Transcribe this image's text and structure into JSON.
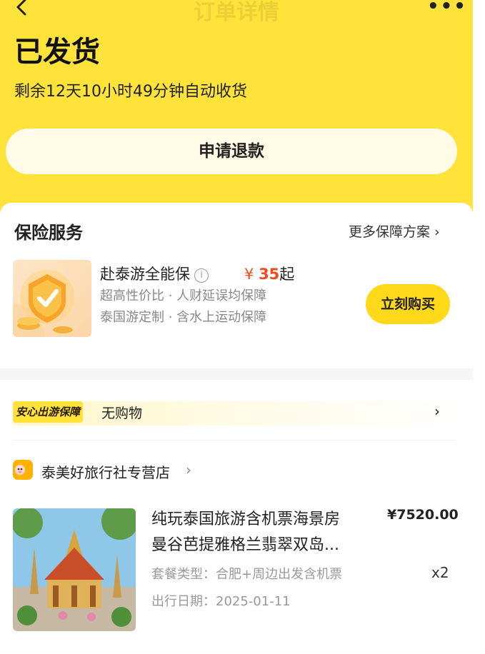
{
  "nav": {
    "title": "订单详情"
  },
  "status": {
    "title": "已发货",
    "subtitle": "剩余12天10小时49分钟自动收货"
  },
  "actions": {
    "refund_label": "申请退款"
  },
  "insurance": {
    "title": "保险服务",
    "more_label": "更多保障方案 ›",
    "product_name": "赴泰游全能保",
    "price_currency": "¥",
    "price_amount": "35",
    "price_suffix": "起",
    "line1": "超高性价比 · 人财延误均保障",
    "line2": "泰国游定制 · 含水上运动保障",
    "buy_label": "立刻购买"
  },
  "guarantee": {
    "badge": "安心出游保障",
    "text": "无购物",
    "chevron": "›"
  },
  "shop": {
    "name": "泰美好旅行社专营店",
    "chevron": "›"
  },
  "product": {
    "title_line1": "纯玩泰国旅游含机票海景房",
    "title_line2": "曼谷芭提雅格兰翡翠双岛...",
    "price": "¥7520.00",
    "package": "套餐类型：合肥+周边出发含机票",
    "date": "出行日期：2025-01-11",
    "quantity": "x2"
  },
  "colors": {
    "brand_yellow": "#ffe33b",
    "price_red": "#f04a1a",
    "button_yellow": "#ffd91a"
  },
  "icons": [
    "back-arrow-icon",
    "more-dots-icon",
    "info-icon",
    "shield-check-icon",
    "shop-logo-icon",
    "chevron-right-icon"
  ]
}
